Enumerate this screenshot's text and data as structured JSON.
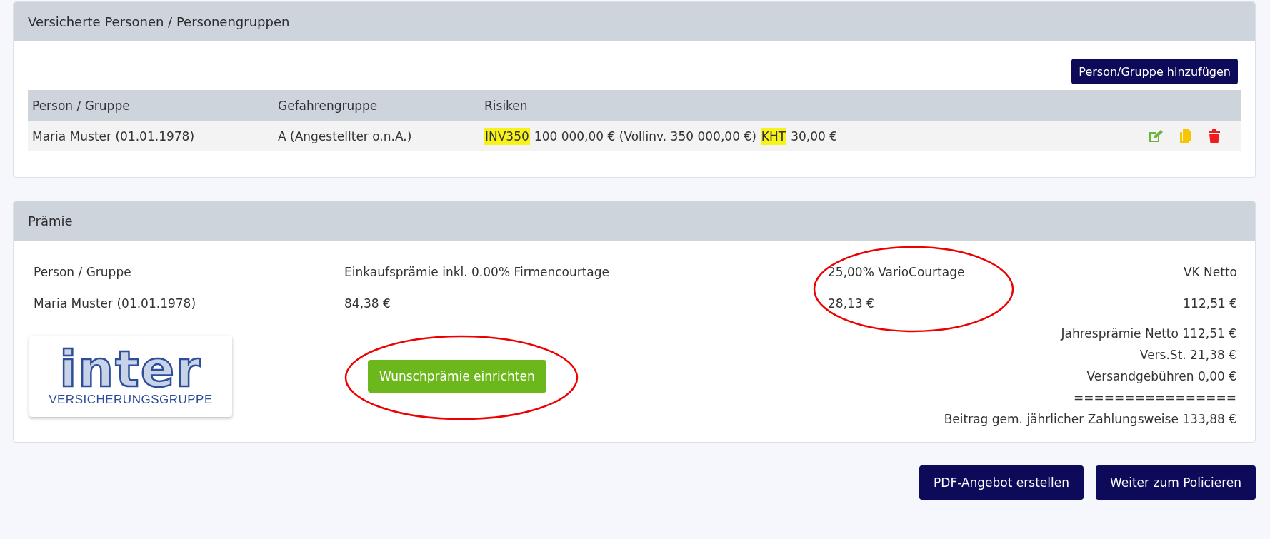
{
  "persons_panel": {
    "title": "Versicherte Personen / Personengruppen",
    "add_button": "Person/Gruppe hinzufügen",
    "table": {
      "columns": [
        "Person / Gruppe",
        "Gefahrengruppe",
        "Risiken"
      ],
      "rows": [
        {
          "person": "Maria Muster (01.01.1978)",
          "group": "A (Angestellter o.n.A.)",
          "risks": [
            {
              "code": "INV350",
              "text": "100 000,00 € (Vollinv. 350 000,00 €)"
            },
            {
              "code": "KHT",
              "text": "30,00 €"
            }
          ],
          "actions": [
            {
              "kind": "edit"
            },
            {
              "kind": "copy"
            },
            {
              "kind": "delete"
            }
          ]
        }
      ]
    }
  },
  "premium_panel": {
    "title": "Prämie",
    "columns": [
      "Person / Gruppe",
      "Einkaufsprämie inkl. 0.00% Firmencourtage",
      "25,00% VarioCourtage",
      "VK Netto"
    ],
    "rows": [
      [
        "Maria Muster (01.01.1978)",
        "84,38 €",
        "28,13 €",
        "112,51 €"
      ]
    ],
    "logo": {
      "wordmark": "inter",
      "tagline": "VERSICHERUNGSGRUPPE"
    },
    "wish_button": "Wunschprämie einrichten",
    "summary": [
      "Jahresprämie Netto 112,51 €",
      "Vers.St. 21,38 €",
      "Versandgebühren 0,00 €",
      "================",
      "Beitrag gem. jährlicher Zahlungsweise 133,88 €"
    ]
  },
  "footer_buttons": [
    "PDF-Angebot erstellen",
    "Weiter zum Policieren"
  ]
}
